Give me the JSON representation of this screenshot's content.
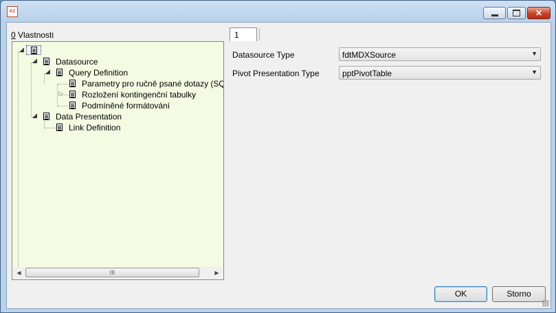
{
  "window": {
    "title": "",
    "app_icon_text": "KZ",
    "icons": {
      "minimize": "minimize-icon",
      "maximize": "maximize-icon",
      "close": "close-icon"
    }
  },
  "left_panel": {
    "label_prefix": "0",
    "label_rest": " Vlastnosti",
    "tree": [
      {
        "label": "",
        "level": 0,
        "expanded": true,
        "selected": true
      },
      {
        "label": "Datasource",
        "level": 1,
        "expanded": true
      },
      {
        "label": "Query Definition",
        "level": 2,
        "expanded": true
      },
      {
        "label": "Parametry pro ručně psané dotazy (SQL i M",
        "level": 3
      },
      {
        "label": "Rozložení kontingenční tabulky",
        "level": 3,
        "collapsed": true
      },
      {
        "label": "Podmíněné formátování",
        "level": 3
      },
      {
        "label": "Data Presentation",
        "level": 1,
        "expanded": true
      },
      {
        "label": "Link Definition",
        "level": 2
      }
    ],
    "scrollbar": {
      "left": "◀",
      "right": "▶",
      "grip": "III"
    }
  },
  "right_panel": {
    "tab_label": "1",
    "fields": [
      {
        "label": "Datasource Type",
        "value": "fdtMDXSource"
      },
      {
        "label": "Pivot Presentation Type",
        "value": "pptPivotTable"
      }
    ]
  },
  "buttons": {
    "ok": "OK",
    "cancel": "Storno"
  },
  "colors": {
    "tree_background": "#f3fbe2",
    "ok_border": "#3c7fb1"
  }
}
